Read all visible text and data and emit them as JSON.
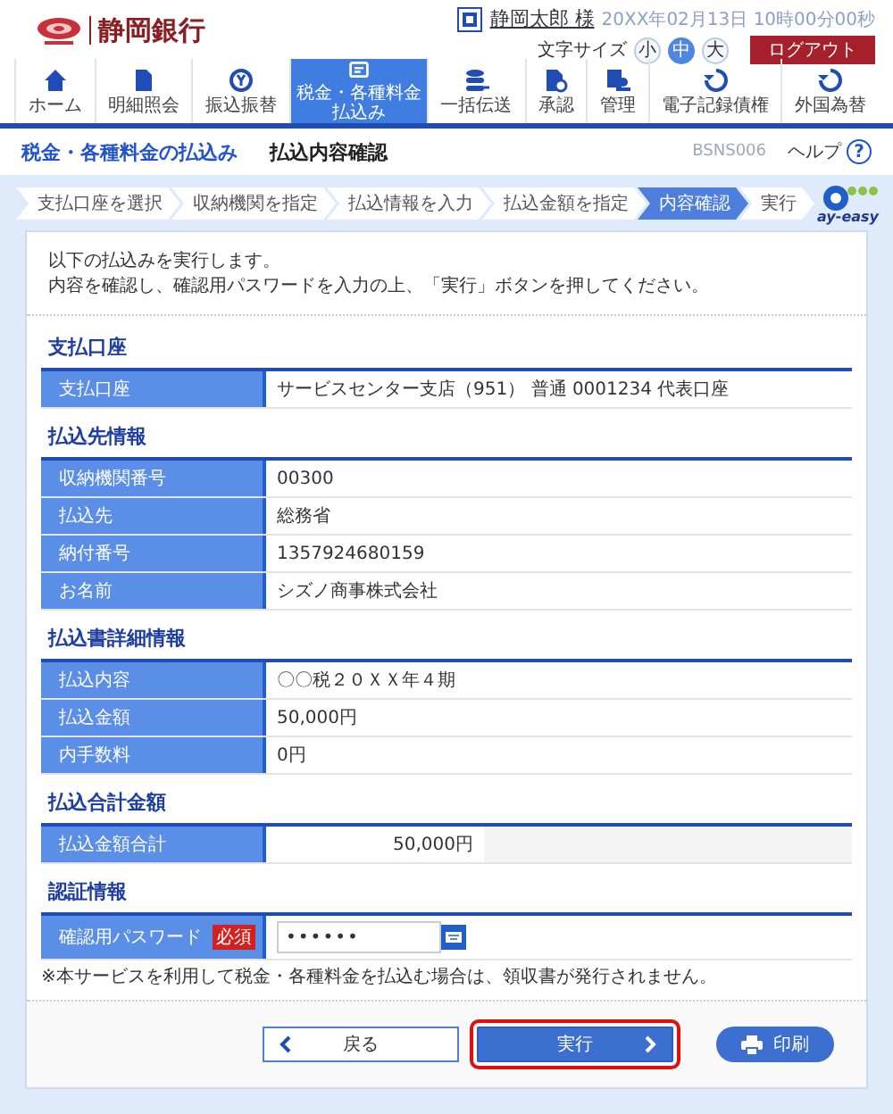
{
  "header": {
    "bank_name": "静岡銀行",
    "user_name": "静岡太郎 様",
    "datetime": "20XX年02月13日 10時00分00秒",
    "font_size": {
      "label": "文字サイズ",
      "options": [
        {
          "label": "小",
          "selected": false
        },
        {
          "label": "中",
          "selected": true
        },
        {
          "label": "大",
          "selected": false
        }
      ]
    },
    "logout": "ログアウト"
  },
  "nav": {
    "items": [
      {
        "label": "ホーム",
        "selected": false
      },
      {
        "label": "明細照会",
        "selected": false
      },
      {
        "label": "振込振替",
        "selected": false
      },
      {
        "label": "税金・各種料金払込み",
        "selected": true
      },
      {
        "label": "一括伝送",
        "selected": false
      },
      {
        "label": "承認",
        "selected": false
      },
      {
        "label": "管理",
        "selected": false
      },
      {
        "label": "電子記録債権",
        "selected": false
      },
      {
        "label": "外国為替",
        "selected": false
      }
    ]
  },
  "page_title": {
    "section": "税金・各種料金の払込み",
    "title": "払込内容確認",
    "screen_id": "BSNS006",
    "help": "ヘルプ",
    "help_icon": "?"
  },
  "steps": [
    {
      "label": "支払口座を選択",
      "selected": false
    },
    {
      "label": "収納機関を指定",
      "selected": false
    },
    {
      "label": "払込情報を入力",
      "selected": false
    },
    {
      "label": "払込金額を指定",
      "selected": false
    },
    {
      "label": "内容確認",
      "selected": true
    },
    {
      "label": "実行",
      "selected": false
    }
  ],
  "payeasy_logo": "ay-easy",
  "intro": [
    "以下の払込みを実行します。",
    "内容を確認し、確認用パスワードを入力の上、「実行」ボタンを押してください。"
  ],
  "sections": [
    {
      "heading": "支払口座",
      "rows": [
        {
          "kind": "text",
          "label": "支払口座",
          "value": "サービスセンター支店（951） 普通 0001234 代表口座"
        }
      ]
    },
    {
      "heading": "払込先情報",
      "rows": [
        {
          "kind": "text",
          "label": "収納機関番号",
          "value": "00300"
        },
        {
          "kind": "text",
          "label": "払込先",
          "value": "総務省"
        },
        {
          "kind": "text",
          "label": "納付番号",
          "value": "1357924680159"
        },
        {
          "kind": "text",
          "label": "お名前",
          "value": "シズノ商事株式会社"
        }
      ]
    },
    {
      "heading": "払込書詳細情報",
      "rows": [
        {
          "kind": "text",
          "label": "払込内容",
          "value": "〇〇税２０ＸＸ年４期"
        },
        {
          "kind": "text",
          "label": "払込金額",
          "value": "50,000円"
        },
        {
          "kind": "text",
          "label": "内手数料",
          "value": "0円"
        }
      ]
    },
    {
      "heading": "払込合計金額",
      "rows": [
        {
          "kind": "amount",
          "label": "払込金額合計",
          "value": "50,000円"
        }
      ]
    },
    {
      "heading": "認証情報",
      "rows": [
        {
          "kind": "password",
          "label": "確認用パスワード",
          "required": "必須",
          "value": "••••••"
        }
      ]
    }
  ],
  "note": "※本サービスを利用して税金・各種料金を払込む場合は、領収書が発行されません。",
  "buttons": [
    {
      "kind": "back",
      "label": "戻る",
      "highlighted": false
    },
    {
      "kind": "execute",
      "label": "実行",
      "highlighted": true
    },
    {
      "kind": "print",
      "label": "印刷",
      "highlighted": false
    }
  ]
}
